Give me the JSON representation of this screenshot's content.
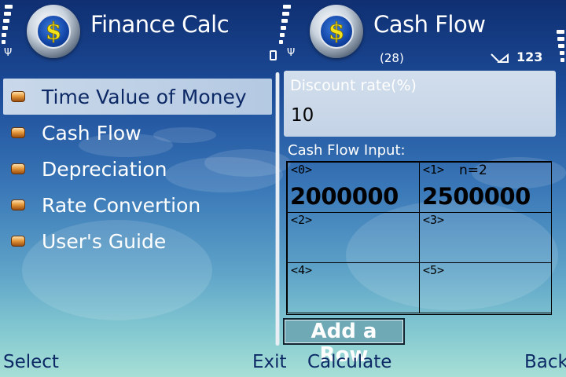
{
  "left_screen": {
    "title": "Finance Calc",
    "menu": [
      {
        "label": "Time Value of Money",
        "selected": true
      },
      {
        "label": "Cash Flow",
        "selected": false
      },
      {
        "label": "Depreciation",
        "selected": false
      },
      {
        "label": "Rate Convertion",
        "selected": false
      },
      {
        "label": "User's Guide",
        "selected": false
      }
    ]
  },
  "right_screen": {
    "title": "Cash Flow",
    "status": {
      "count": "(28)",
      "input_mode": "123"
    },
    "discount_rate": {
      "label": "Discount rate(%)",
      "value": "10"
    },
    "cash_flow_label": "Cash Flow Input:",
    "cells": [
      {
        "index": "<0>",
        "value": "2000000",
        "note": ""
      },
      {
        "index": "<1>",
        "value": "2500000",
        "note": "n=2"
      },
      {
        "index": "<2>",
        "value": "",
        "note": ""
      },
      {
        "index": "<3>",
        "value": "",
        "note": ""
      },
      {
        "index": "<4>",
        "value": "",
        "note": ""
      },
      {
        "index": "<5>",
        "value": "",
        "note": ""
      }
    ],
    "add_row_label": "Add a Row"
  },
  "softkeys": {
    "select": "Select",
    "exit": "Exit",
    "calculate": "Calculate",
    "back": "Back"
  },
  "icons": {
    "logo": "finance-calc-logo-icon",
    "signal": "signal-strength-icon",
    "antenna": "antenna-icon",
    "battery": "battery-icon",
    "bullet": "orange-bullet-icon",
    "pen": "pen-input-icon"
  },
  "colors": {
    "selected_bg": "#c9d8ea",
    "softkey_text": "#0d2a66",
    "bullet": "#e89a3c"
  }
}
